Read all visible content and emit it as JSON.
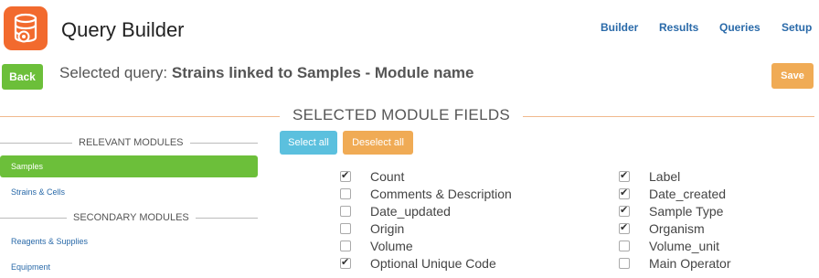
{
  "header": {
    "title": "Query Builder",
    "nav": [
      "Builder",
      "Results",
      "Queries",
      "Setup"
    ]
  },
  "toolbar": {
    "back_label": "Back",
    "query_prefix": "Selected query:",
    "query_name": "Strains linked to Samples - Module name",
    "save_label": "Save"
  },
  "section": {
    "title": "SELECTED MODULE FIELDS"
  },
  "sidebar": {
    "relevant_heading": "RELEVANT MODULES",
    "relevant_items": [
      "Samples",
      "Strains & Cells"
    ],
    "secondary_heading": "SECONDARY MODULES",
    "secondary_items": [
      "Reagents & Supplies",
      "Equipment"
    ]
  },
  "actions": {
    "select_all": "Select all",
    "deselect_all": "Deselect all"
  },
  "fields_left": [
    {
      "label": "Count",
      "checked": true
    },
    {
      "label": "Comments & Description",
      "checked": false
    },
    {
      "label": "Date_updated",
      "checked": false
    },
    {
      "label": "Origin",
      "checked": false
    },
    {
      "label": "Volume",
      "checked": false
    },
    {
      "label": "Optional Unique Code",
      "checked": true
    }
  ],
  "fields_right": [
    {
      "label": "Label",
      "checked": true
    },
    {
      "label": "Date_created",
      "checked": true
    },
    {
      "label": "Sample Type",
      "checked": true
    },
    {
      "label": "Organism",
      "checked": true
    },
    {
      "label": "Volume_unit",
      "checked": false
    },
    {
      "label": "Main Operator",
      "checked": false
    }
  ],
  "colors": {
    "brand": "#f26a2e",
    "green": "#6cbf3a",
    "orange": "#f0ab55",
    "blue": "#5bc0de",
    "link": "#2a6aa9"
  }
}
